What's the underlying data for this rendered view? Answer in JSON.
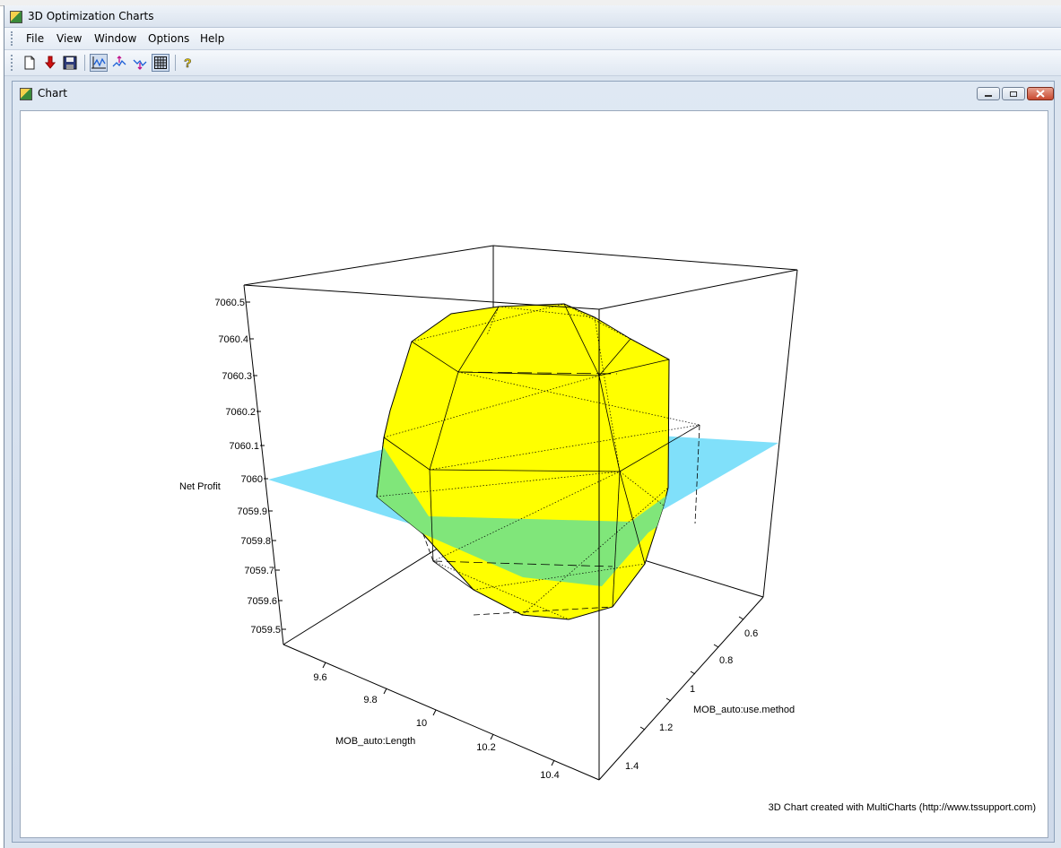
{
  "app": {
    "title": "3D Optimization Charts"
  },
  "menu": {
    "items": [
      "File",
      "View",
      "Window",
      "Options",
      "Help"
    ]
  },
  "mdi": {
    "title": "Chart"
  },
  "chart_data": {
    "type": "surface3d",
    "zlabel": "Net Profit",
    "xlabel": "MOB_auto:Length",
    "ylabel": "MOB_auto:use.method",
    "z_ticks": [
      "7059.5",
      "7059.6",
      "7059.7",
      "7059.8",
      "7059.9",
      "7060",
      "7060.1",
      "7060.2",
      "7060.3",
      "7060.4",
      "7060.5"
    ],
    "x_ticks": [
      "9.6",
      "9.8",
      "10",
      "10.2",
      "10.4"
    ],
    "y_ticks": [
      "0.6",
      "0.8",
      "1",
      "1.2",
      "1.4"
    ],
    "reference_plane_z": 7060,
    "surface_color": "#ffff00",
    "plane_color": "#80e0fa",
    "intersection_color": "#80e67a",
    "footer": "3D Chart created with MultiCharts (http://www.tssupport.com)"
  }
}
